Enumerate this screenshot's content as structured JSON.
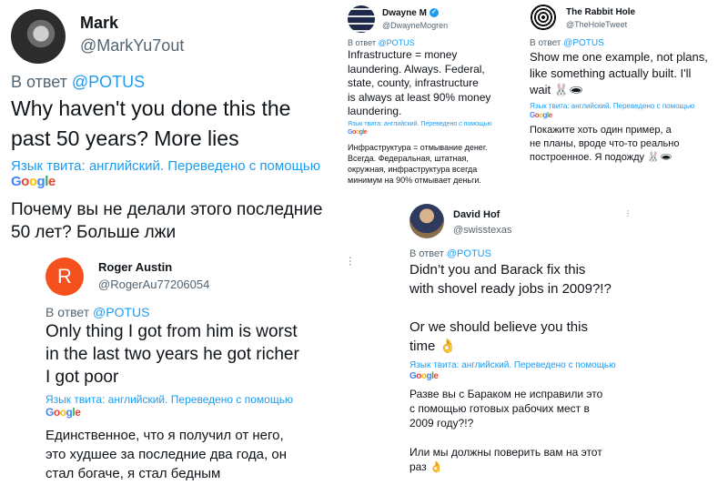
{
  "tweets": {
    "mark": {
      "name": "Mark",
      "handle": "@MarkYu7out",
      "reply_prefix": "В ответ",
      "reply_to": "@POTUS",
      "text": "Why haven't you done this the\npast 50 years? More lies",
      "translated_label": "Язык твита: английский. Переведено с помощью",
      "translation": "Почему вы не делали этого последние\n50 лет? Больше лжи"
    },
    "dwayne": {
      "name": "Dwayne M",
      "handle": "@DwayneMogren",
      "reply_prefix": "В ответ",
      "reply_to": "@POTUS",
      "text": "Infrastructure = money\nlaundering. Always. Federal,\nstate, county, infrastructure\nis always at least 90% money\nlaundering.",
      "translated_label": "Язык твита: английский. Переведено с помощью",
      "translation": "Инфраструктура = отмывание денег.\nВсегда. Федеральная, штатная,\nокружная, инфраструктура всегда\nминимум на 90% отмывает деньги."
    },
    "rabbit": {
      "name": "The Rabbit Hole",
      "handle": "@TheHoleTweet",
      "reply_prefix": "В ответ",
      "reply_to": "@POTUS",
      "text": "Show me one example, not plans,\nlike something actually built. I'll\nwait 🐰🕳",
      "translated_label": "Язык твита: английский. Переведено с помощью",
      "translation": "Покажите хоть один пример, а\nне планы, вроде что-то реально\nпостроенное. Я подожду 🐰🕳"
    },
    "roger": {
      "name": "Roger Austin",
      "handle": "@RogerAu77206054",
      "avatar_letter": "R",
      "reply_prefix": "В ответ",
      "reply_to": "@POTUS",
      "text": "Only thing I got from him is worst\nin the last two years  he got richer\nI got poor",
      "translated_label": "Язык твита: английский. Переведено с помощью",
      "translation": "Единственное, что я получил от него,\nэто худшее за последние два года, он\nстал богаче, я стал бедным"
    },
    "david": {
      "name": "David Hof",
      "handle": "@swisstexas",
      "reply_prefix": "В ответ",
      "reply_to": "@POTUS",
      "text": "Didn’t you and Barack fix this\nwith shovel ready jobs in 2009?!?\n\nOr we should believe you this\ntime 👌",
      "translated_label": "Язык твита: английский. Переведено с помощью",
      "translation": "Разве вы с Бараком не исправили это\nс помощью готовых рабочих мест в\n2009 году?!?\n\nИли мы должны поверить вам на этот\nраз 👌"
    }
  },
  "google_logo": {
    "G": "G",
    "o1": "o",
    "o2": "o",
    "g": "g",
    "l": "l",
    "e": "e"
  },
  "colors": {
    "link": "#1d9bf0",
    "secondary": "#536471",
    "roger_avatar": "#f4511e"
  }
}
